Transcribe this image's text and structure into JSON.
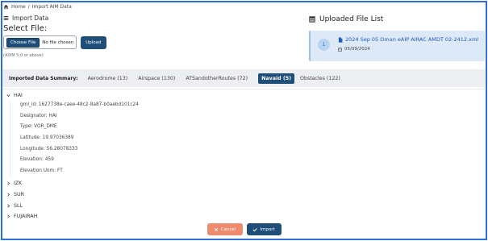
{
  "breadcrumb": {
    "home": "Home",
    "separator": "/",
    "current": "Import AIM Data"
  },
  "import_section": {
    "title": "Import Data",
    "select_file_label": "Select File:",
    "choose_file_label": "Choose File",
    "no_file_text": "No file chosen",
    "upload_label": "Upload",
    "hint": "(AIXM 5.0 or above)"
  },
  "uploaded_section": {
    "title": "Uploaded File List",
    "files": [
      {
        "index": "1",
        "name": "2024 Sep 05 Oman eAIP AIRAC AMDT 02-2412.xml",
        "date": "05/09/2024"
      }
    ]
  },
  "summary": {
    "label": "Imported Data Summary:",
    "tabs": [
      {
        "label": "Aerodrome (13)",
        "active": false
      },
      {
        "label": "Airspace (130)",
        "active": false
      },
      {
        "label": "ATSandotherRoutes (72)",
        "active": false
      },
      {
        "label": "Navaid (5)",
        "active": true
      },
      {
        "label": "Obstacles (122)",
        "active": false
      }
    ]
  },
  "tree": {
    "open_node": {
      "title": "HAI",
      "properties": [
        "gml_id: 1627738e-caee-48c2-8a87-b0aebd101c24",
        "Designator: HAI",
        "Type: VOR_DME",
        "Latitude: 19.97036389",
        "Longitude: 56.28078333",
        "Elevation: 459",
        "Elevation Uom: FT"
      ]
    },
    "collapsed_nodes": [
      "IZK",
      "SUR",
      "SLL",
      "FUJAIRAH"
    ]
  },
  "footer": {
    "cancel_label": "Cancel",
    "import_label": "Import"
  },
  "colors": {
    "primary": "#1f4e79",
    "cancel": "#ef8a6e",
    "link": "#1d5bbf",
    "card_bg": "#dde9f7",
    "summary_bg": "#eceef2",
    "frame_border": "#2f6fd6"
  }
}
